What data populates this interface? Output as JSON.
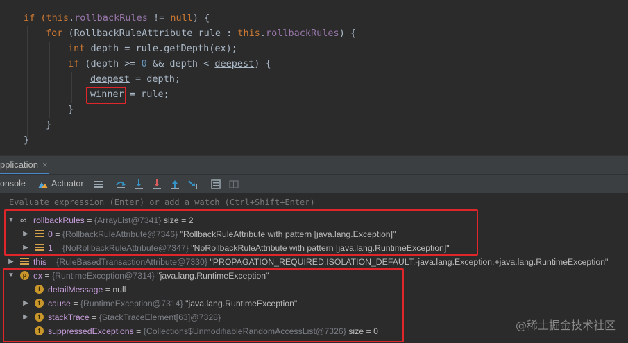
{
  "editor": {
    "lines": [
      {
        "indent": 0,
        "tokens": [
          [
            "kw",
            "if ("
          ],
          [
            "kw",
            "this"
          ],
          [
            "txt",
            "."
          ],
          [
            "fld",
            "rollbackRules"
          ],
          [
            "txt",
            " != "
          ],
          [
            "kw",
            "null"
          ],
          [
            "txt",
            ") {"
          ]
        ]
      },
      {
        "indent": 1,
        "tokens": [
          [
            "kw",
            "for "
          ],
          [
            "txt",
            "(RollbackRuleAttribute rule : "
          ],
          [
            "kw",
            "this"
          ],
          [
            "txt",
            "."
          ],
          [
            "fld",
            "rollbackRules"
          ],
          [
            "txt",
            ") {"
          ]
        ]
      },
      {
        "indent": 2,
        "tokens": [
          [
            "kw",
            "int "
          ],
          [
            "txt",
            "depth = rule.getDepth(ex);"
          ]
        ]
      },
      {
        "indent": 2,
        "tokens": [
          [
            "kw",
            "if "
          ],
          [
            "txt",
            "(depth >= "
          ],
          [
            "num",
            "0"
          ],
          [
            "txt",
            " && depth < "
          ],
          [
            "txtul",
            "deepest"
          ],
          [
            "txt",
            ") {"
          ]
        ]
      },
      {
        "indent": 3,
        "tokens": [
          [
            "txtul",
            "deepest"
          ],
          [
            "txt",
            " = depth;"
          ]
        ]
      },
      {
        "indent": 3,
        "tokens": [
          [
            "txtul",
            "winner"
          ],
          [
            "txt",
            " = rule;"
          ]
        ]
      },
      {
        "indent": 2,
        "tokens": [
          [
            "txt",
            "}"
          ]
        ]
      },
      {
        "indent": 1,
        "tokens": [
          [
            "txt",
            "}"
          ]
        ]
      },
      {
        "indent": 0,
        "tokens": [
          [
            "txt",
            "}"
          ]
        ]
      }
    ]
  },
  "tab": {
    "label": "pplication",
    "close": "×"
  },
  "toolbar": {
    "console_label": "onsole",
    "actuator_label": "Actuator"
  },
  "evaluate": {
    "placeholder": "Evaluate expression (Enter) or add a watch (Ctrl+Shift+Enter)"
  },
  "variables": [
    {
      "level": 0,
      "expanded": true,
      "icon": "watch",
      "name": "rollbackRules",
      "ref": "{ArrayList@7341}",
      "value": " size = 2"
    },
    {
      "level": 1,
      "expanded": false,
      "icon": "list",
      "name": "0",
      "ref": "{RollbackRuleAttribute@7346}",
      "value": "\"RollbackRuleAttribute with pattern [java.lang.Exception]\""
    },
    {
      "level": 1,
      "expanded": false,
      "icon": "list",
      "name": "1",
      "ref": "{NoRollbackRuleAttribute@7347}",
      "value": "\"NoRollbackRuleAttribute with pattern [java.lang.RuntimeException]\""
    },
    {
      "level": 0,
      "expanded": false,
      "icon": "list",
      "name": "this",
      "ref": "{RuleBasedTransactionAttribute@7330}",
      "value": "\"PROPAGATION_REQUIRED,ISOLATION_DEFAULT,-java.lang.Exception,+java.lang.RuntimeException\""
    },
    {
      "level": 0,
      "expanded": true,
      "icon": "p",
      "name": "ex",
      "ref": "{RuntimeException@7314}",
      "value": "\"java.lang.RuntimeException\""
    },
    {
      "level": 1,
      "expanded": null,
      "icon": "f",
      "name": "detailMessage",
      "ref": "",
      "value": "null"
    },
    {
      "level": 1,
      "expanded": false,
      "icon": "f",
      "name": "cause",
      "ref": "{RuntimeException@7314}",
      "value": "\"java.lang.RuntimeException\""
    },
    {
      "level": 1,
      "expanded": false,
      "icon": "f",
      "name": "stackTrace",
      "ref": "{StackTraceElement[63]@7328}",
      "value": ""
    },
    {
      "level": 1,
      "expanded": null,
      "icon": "f",
      "name": "suppressedExceptions",
      "ref": "{Collections$UnmodifiableRandomAccessList@7326}",
      "value": " size = 0"
    }
  ],
  "watermark": "@稀土掘金技术社区",
  "colors": {
    "highlight": "#e0262a",
    "keyword": "#cc7832",
    "field": "#9876aa",
    "var_name": "#c69ddb"
  }
}
